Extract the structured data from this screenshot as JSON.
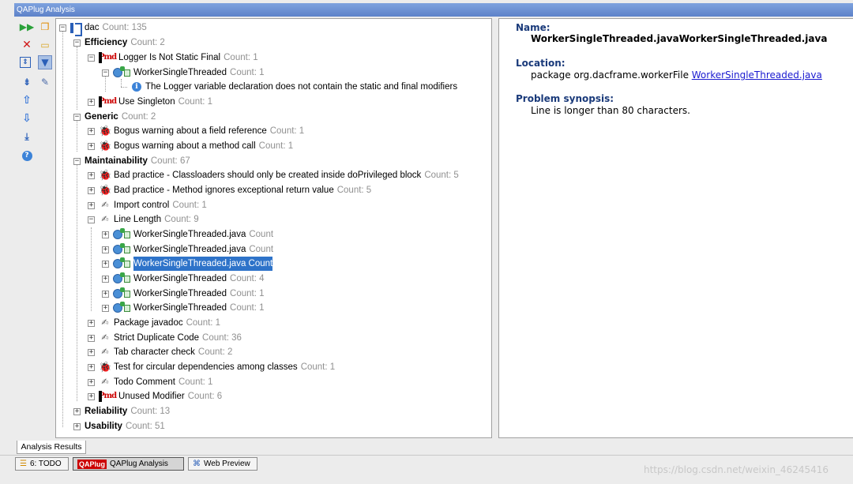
{
  "window": {
    "title": "QAPlug Analysis"
  },
  "toolbar": {
    "icons": [
      "run-icon",
      "rerun-icon",
      "close-icon",
      "folder-icon",
      "expand-all-icon",
      "filter-icon",
      "collapse-all-icon",
      "settings-icon",
      "previous-icon",
      "next-icon",
      "export-icon",
      "help-icon"
    ]
  },
  "tree": {
    "root": {
      "label": "dac",
      "count": "Count: 135"
    },
    "rows": [
      {
        "label": "Efficiency",
        "count": "Count: 2"
      },
      {
        "label": "Logger Is Not Static Final",
        "count": "Count: 1"
      },
      {
        "label": "WorkerSingleThreaded",
        "count": "Count: 1"
      },
      {
        "label": "The Logger variable declaration does not contain the static and final modifiers",
        "count": ""
      },
      {
        "label": "Use Singleton",
        "count": "Count: 1"
      },
      {
        "label": "Generic",
        "count": "Count: 2"
      },
      {
        "label": "Bogus warning about a field reference",
        "count": "Count: 1"
      },
      {
        "label": "Bogus warning about a method call",
        "count": "Count: 1"
      },
      {
        "label": "Maintainability",
        "count": "Count: 67"
      },
      {
        "label": "Bad practice - Classloaders should only be created inside doPrivileged block",
        "count": "Count: 5"
      },
      {
        "label": "Bad practice - Method ignores exceptional return value",
        "count": "Count: 5"
      },
      {
        "label": "Import control",
        "count": "Count: 1"
      },
      {
        "label": "Line Length",
        "count": "Count: 9"
      },
      {
        "label": "WorkerSingleThreaded.java",
        "count": "Count"
      },
      {
        "label": "WorkerSingleThreaded.java",
        "count": "Count"
      },
      {
        "label": "WorkerSingleThreaded.java Count",
        "count": ""
      },
      {
        "label": "WorkerSingleThreaded",
        "count": "Count: 4"
      },
      {
        "label": "WorkerSingleThreaded",
        "count": "Count: 1"
      },
      {
        "label": "WorkerSingleThreaded",
        "count": "Count: 1"
      },
      {
        "label": "Package javadoc",
        "count": "Count: 1"
      },
      {
        "label": "Strict Duplicate Code",
        "count": "Count: 36"
      },
      {
        "label": "Tab character check",
        "count": "Count: 2"
      },
      {
        "label": "Test for circular dependencies among classes",
        "count": "Count: 1"
      },
      {
        "label": "Todo Comment",
        "count": "Count: 1"
      },
      {
        "label": "Unused Modifier",
        "count": "Count: 6"
      },
      {
        "label": "Reliability",
        "count": "Count: 13"
      },
      {
        "label": "Usability",
        "count": "Count: 51"
      }
    ]
  },
  "detail": {
    "name_label": "Name:",
    "name_value": "WorkerSingleThreaded.javaWorkerSingleThreaded.java",
    "location_label": "Location:",
    "location_prefix": "package org.dacframe.workerFile ",
    "location_link": "WorkerSingleThreaded.java",
    "synopsis_label": "Problem synopsis:",
    "synopsis_value": "Line is longer than 80 characters."
  },
  "tabs": {
    "analysis_results": "Analysis Results"
  },
  "bottom": {
    "todo": "6: TODO",
    "qaplug_logo": "QAPlug",
    "qaplug": "QAPlug Analysis",
    "web_preview": "Web Preview"
  },
  "watermark": "https://blog.csdn.net/weixin_46245416"
}
